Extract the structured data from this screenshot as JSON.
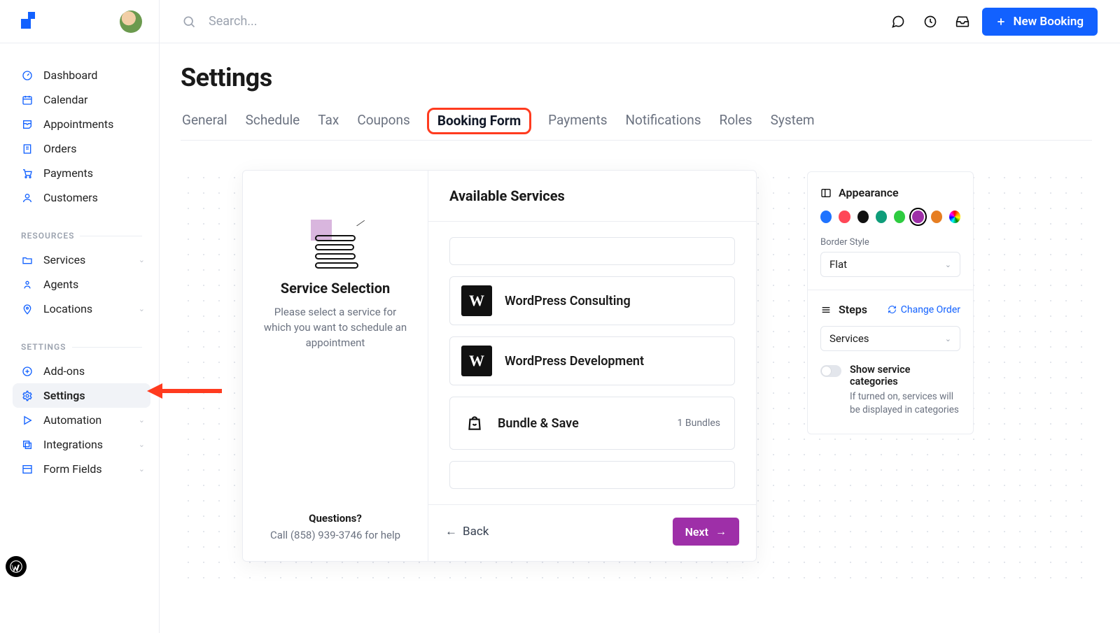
{
  "header": {
    "search_placeholder": "Search...",
    "new_booking_label": "New Booking"
  },
  "sidebar": {
    "primary": [
      {
        "icon": "gauge",
        "label": "Dashboard"
      },
      {
        "icon": "calendar",
        "label": "Calendar"
      },
      {
        "icon": "inbox",
        "label": "Appointments"
      },
      {
        "icon": "receipt",
        "label": "Orders"
      },
      {
        "icon": "cart",
        "label": "Payments"
      },
      {
        "icon": "users",
        "label": "Customers"
      }
    ],
    "resources_title": "RESOURCES",
    "resources": [
      {
        "icon": "folder",
        "label": "Services",
        "expandable": true
      },
      {
        "icon": "agent",
        "label": "Agents"
      },
      {
        "icon": "pin",
        "label": "Locations",
        "expandable": true
      }
    ],
    "settings_title": "SETTINGS",
    "settings": [
      {
        "icon": "plus-circle",
        "label": "Add-ons"
      },
      {
        "icon": "gear",
        "label": "Settings",
        "active": true
      },
      {
        "icon": "play",
        "label": "Automation",
        "expandable": true
      },
      {
        "icon": "copy",
        "label": "Integrations",
        "expandable": true
      },
      {
        "icon": "layout",
        "label": "Form Fields",
        "expandable": true
      }
    ]
  },
  "page": {
    "title": "Settings"
  },
  "tabs": [
    {
      "label": "General"
    },
    {
      "label": "Schedule"
    },
    {
      "label": "Tax"
    },
    {
      "label": "Coupons"
    },
    {
      "label": "Booking Form",
      "highlight": true
    },
    {
      "label": "Payments"
    },
    {
      "label": "Notifications"
    },
    {
      "label": "Roles"
    },
    {
      "label": "System"
    }
  ],
  "card": {
    "left": {
      "heading": "Service Selection",
      "description": "Please select a service for which you want to schedule an appointment",
      "questions_label": "Questions?",
      "help_line": "Call (858) 939-3746 for help"
    },
    "right": {
      "heading": "Available Services",
      "services": [
        {
          "type": "logo",
          "name": "WordPress Consulting"
        },
        {
          "type": "logo",
          "name": "WordPress Development"
        }
      ],
      "bundle": {
        "name": "Bundle & Save",
        "meta": "1 Bundles"
      },
      "back": "Back",
      "next": "Next"
    }
  },
  "panel": {
    "appearance_title": "Appearance",
    "colors": [
      "#1f73ff",
      "#ff4757",
      "#111111",
      "#0f9d7a",
      "#2ecc40",
      "#9e2fa8",
      "#e67e22",
      "rainbow"
    ],
    "selected_color_index": 5,
    "border_style_label": "Border Style",
    "border_style_value": "Flat",
    "steps_title": "Steps",
    "change_order": "Change Order",
    "steps_value": "Services",
    "toggle_label": "Show service categories",
    "toggle_sub": "If turned on, services will be displayed in categories"
  }
}
